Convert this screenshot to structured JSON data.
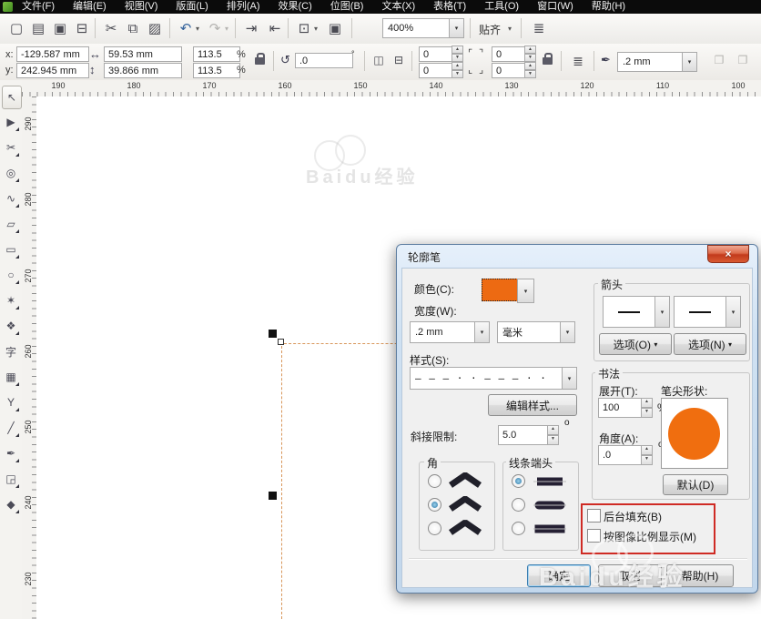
{
  "ui": {
    "caret_down": "▾",
    "spin_up": "▲",
    "spin_down": "▼",
    "close_glyph": "×",
    "degree": "°",
    "degree_small": "o",
    "percent": "%",
    "corner_bracket_tl": "⌜",
    "corner_bracket_bl": "⌞",
    "corner_bracket_tr": "⌝",
    "corner_bracket_br": "⌟"
  },
  "colors": {
    "accent_orange": "#ED6A12",
    "nib_orange": "#F06E0F",
    "annotation_red": "#CF2B24",
    "selection_dash_orange": "#D8965A"
  },
  "menu": {
    "items": [
      {
        "label": "文件(F)"
      },
      {
        "label": "编辑(E)"
      },
      {
        "label": "视图(V)"
      },
      {
        "label": "版面(L)"
      },
      {
        "label": "排列(A)"
      },
      {
        "label": "效果(C)"
      },
      {
        "label": "位图(B)"
      },
      {
        "label": "文本(X)"
      },
      {
        "label": "表格(T)"
      },
      {
        "label": "工具(O)"
      },
      {
        "label": "窗口(W)"
      },
      {
        "label": "帮助(H)"
      }
    ]
  },
  "toolbar": {
    "icons": [
      {
        "name": "new-document-icon",
        "glyph": "▢"
      },
      {
        "name": "open-folder-icon",
        "glyph": "▤"
      },
      {
        "name": "save-icon",
        "glyph": "▣"
      },
      {
        "name": "print-icon",
        "glyph": "⊟"
      },
      {
        "name": "cut-icon",
        "glyph": "✂"
      },
      {
        "name": "copy-icon",
        "glyph": "⧉"
      },
      {
        "name": "paste-icon",
        "glyph": "▨"
      },
      {
        "name": "undo-icon",
        "glyph": "↶"
      },
      {
        "name": "redo-icon",
        "glyph": "↷"
      },
      {
        "name": "import-icon",
        "glyph": "⇥"
      },
      {
        "name": "export-icon",
        "glyph": "⇤"
      },
      {
        "name": "app-launcher-icon",
        "glyph": "⊡"
      },
      {
        "name": "welcome-screen-icon",
        "glyph": "▣"
      }
    ],
    "zoom_value": "400%",
    "snap_label": "贴齐",
    "options_glyph": "≣"
  },
  "property_bar": {
    "x_label": "x:",
    "x_value": "-129.587 mm",
    "y_label": "y:",
    "y_value": "242.945 mm",
    "width_icon_glyph": "↔",
    "width_value": "59.53 mm",
    "height_icon_glyph": "↕",
    "height_value": "39.866 mm",
    "scale_h": "113.5",
    "scale_v": "113.5",
    "rotation_icon_glyph": "↺",
    "rotation_value": ".0",
    "mirror_h_glyph": "◫",
    "mirror_v_glyph": "⊟",
    "corner_tl": "0",
    "corner_tr": "0",
    "corner_bl": "0",
    "corner_br": "0",
    "wrap_icon_glyph": "≣",
    "nib_icon_glyph": "✒",
    "outline_width": ".2 mm",
    "disabled_glyph_1": "❐",
    "disabled_glyph_2": "❐"
  },
  "ruler": {
    "h_labels": [
      "190",
      "180",
      "170",
      "160",
      "150",
      "140",
      "130",
      "120",
      "110",
      "100"
    ],
    "v_labels": [
      "290",
      "280",
      "270",
      "260",
      "250",
      "240",
      "230"
    ]
  },
  "toolbox": {
    "tools": [
      {
        "name": "pick-tool",
        "glyph": "↖"
      },
      {
        "name": "shape-tool",
        "glyph": "▶"
      },
      {
        "name": "crop-tool",
        "glyph": "✂"
      },
      {
        "name": "zoom-tool",
        "glyph": "◎"
      },
      {
        "name": "freehand-tool",
        "glyph": "∿"
      },
      {
        "name": "smart-fill-tool",
        "glyph": "▱"
      },
      {
        "name": "rectangle-tool",
        "glyph": "▭"
      },
      {
        "name": "ellipse-tool",
        "glyph": "○"
      },
      {
        "name": "polygon-tool",
        "glyph": "✶"
      },
      {
        "name": "basic-shapes-tool",
        "glyph": "❖"
      },
      {
        "name": "text-tool",
        "glyph": "字"
      },
      {
        "name": "table-tool",
        "glyph": "▦"
      },
      {
        "name": "dimension-tool",
        "glyph": "Y"
      },
      {
        "name": "eyedropper-tool",
        "glyph": "╱"
      },
      {
        "name": "outline-pen-tool",
        "glyph": "✒"
      },
      {
        "name": "fill-tool",
        "glyph": "◲"
      },
      {
        "name": "interactive-fill-tool",
        "glyph": "◆"
      }
    ]
  },
  "watermark": {
    "text": "Baidu经验"
  },
  "dialog": {
    "title": "轮廓笔",
    "color_label": "颜色(C):",
    "width_label": "宽度(W):",
    "width_value": ".2 mm",
    "unit_value": "毫米",
    "style_label": "样式(S):",
    "style_pattern": "– – – · · – – – · ·",
    "edit_style_button": "编辑样式...",
    "miter_label": "斜接限制:",
    "miter_value": "5.0",
    "corner_group": "角",
    "corner_selected_index": 1,
    "caps_group": "线条端头",
    "caps_selected_index": 0,
    "arrows_group": "箭头",
    "options_left_button": "选项(O)",
    "options_right_button": "选项(N)",
    "calligraphy_group": "书法",
    "stretch_label": "展开(T):",
    "stretch_value": "100",
    "angle_label": "角度(A):",
    "angle_value": ".0",
    "nib_label": "笔尖形状:",
    "default_button": "默认(D)",
    "checkbox_behind_fill": "后台填充(B)",
    "checkbox_behind_fill_checked": false,
    "checkbox_scale_image": "按图像比例显示(M)",
    "checkbox_scale_image_checked": false,
    "ok_button": "确定",
    "cancel_button": "取消",
    "help_button": "帮助(H)"
  }
}
